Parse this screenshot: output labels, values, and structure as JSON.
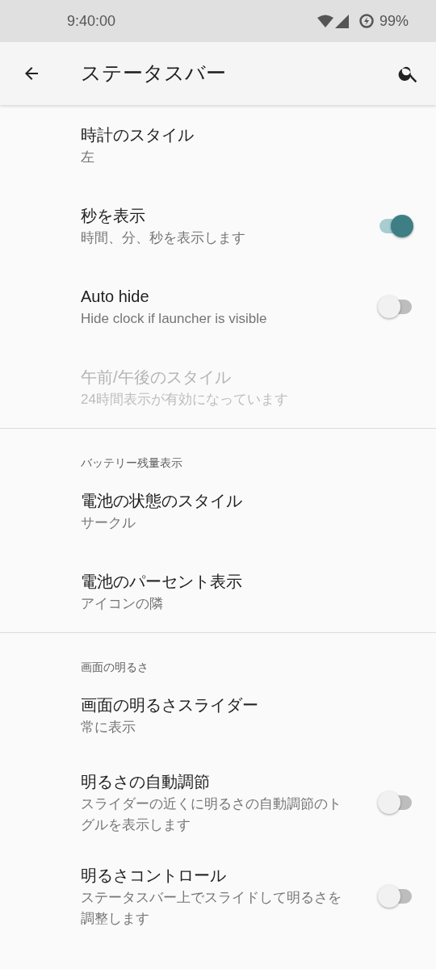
{
  "status_bar": {
    "time": "9:40:00",
    "battery": "99%"
  },
  "app_bar": {
    "title": "ステータスバー"
  },
  "sections": [
    {
      "items": [
        {
          "kind": "text",
          "title": "時計のスタイル",
          "summary": "左",
          "disabled": false
        },
        {
          "kind": "switch",
          "title": "秒を表示",
          "summary": "時間、分、秒を表示します",
          "disabled": false,
          "on": true
        },
        {
          "kind": "switch",
          "title": "Auto hide",
          "summary": "Hide clock if launcher is visible",
          "disabled": false,
          "on": false
        },
        {
          "kind": "text",
          "title": "午前/午後のスタイル",
          "summary": "24時間表示が有効になっています",
          "disabled": true
        }
      ]
    },
    {
      "header": "バッテリー残量表示",
      "items": [
        {
          "kind": "text",
          "title": "電池の状態のスタイル",
          "summary": "サークル",
          "disabled": false
        },
        {
          "kind": "text",
          "title": "電池のパーセント表示",
          "summary": "アイコンの隣",
          "disabled": false
        }
      ]
    },
    {
      "header": "画面の明るさ",
      "items": [
        {
          "kind": "text",
          "title": "画面の明るさスライダー",
          "summary": "常に表示",
          "disabled": false
        },
        {
          "kind": "switch",
          "title": "明るさの自動調節",
          "summary": "スライダーの近くに明るさの自動調節のトグルを表示します",
          "disabled": false,
          "on": false
        },
        {
          "kind": "switch",
          "title": "明るさコントロール",
          "summary": "ステータスバー上でスライドして明るさを調整します",
          "disabled": false,
          "on": false
        }
      ]
    }
  ]
}
